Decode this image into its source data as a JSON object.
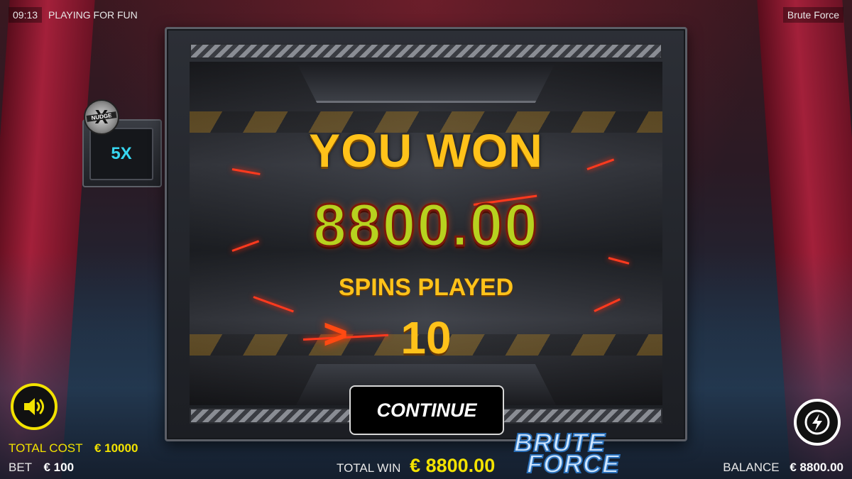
{
  "topbar": {
    "time": "09:13",
    "mode": "PLAYING FOR FUN",
    "game_title": "Brute Force"
  },
  "popup": {
    "heading": "YOU WON",
    "amount": "8800.00",
    "spins_label": "SPINS PLAYED",
    "spins_value": "10",
    "continue_label": "CONTINUE"
  },
  "nudge": {
    "badge_text": "NUDGE",
    "multiplier": "5X"
  },
  "footer": {
    "total_cost_label": "TOTAL COST",
    "total_cost_value": "€ 10000",
    "bet_label": "BET",
    "bet_value": "€ 100",
    "total_win_label": "TOTAL WIN",
    "total_win_value": "€ 8800.00",
    "balance_label": "BALANCE",
    "balance_value": "€ 8800.00"
  },
  "logo": {
    "line1": "BRUTE",
    "line2": "FORCE"
  },
  "icons": {
    "sound": "speaker-icon",
    "turbo": "lightning-icon"
  },
  "colors": {
    "accent_yellow": "#f2e200",
    "win_gold": "#ffc21a",
    "amount_green": "#b7d21f",
    "nudge_cyan": "#37d6f0"
  }
}
